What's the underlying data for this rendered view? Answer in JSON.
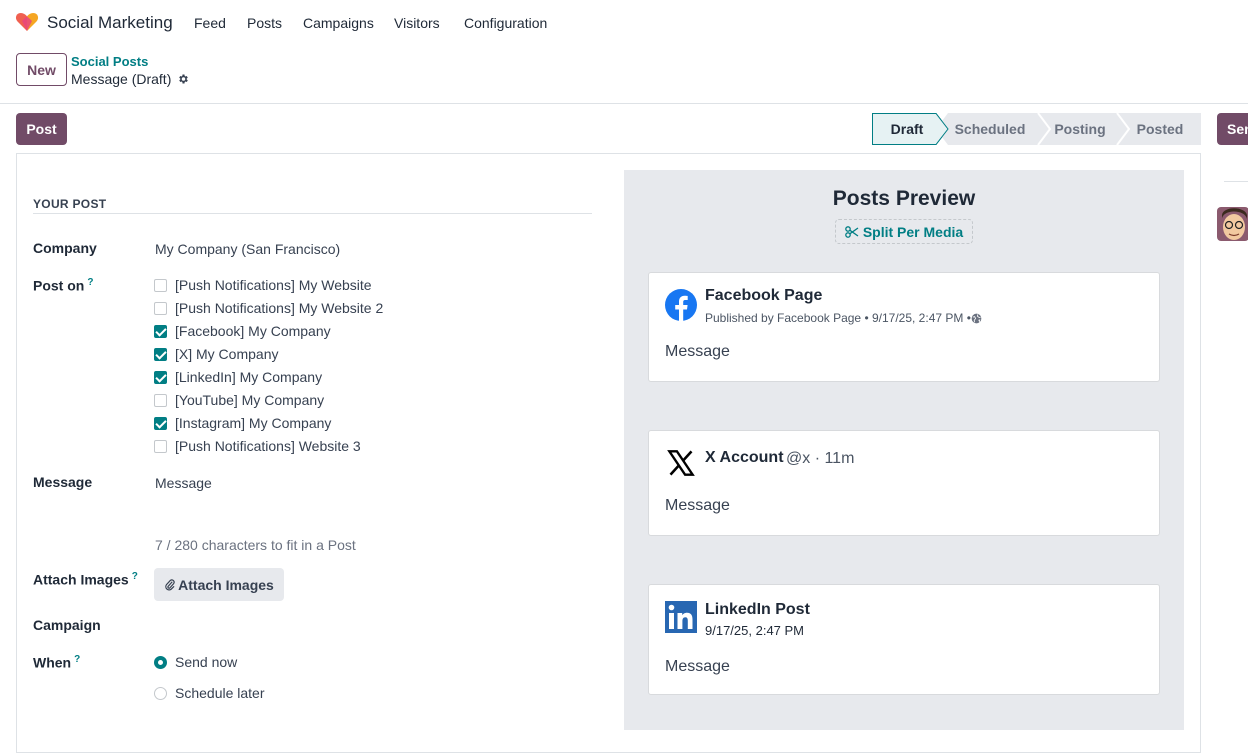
{
  "app": {
    "name": "Social Marketing",
    "menu": [
      "Feed",
      "Posts",
      "Campaigns",
      "Visitors",
      "Configuration"
    ]
  },
  "control_panel": {
    "new_label": "New",
    "breadcrumb_parent": "Social Posts",
    "breadcrumb_current": "Message (Draft)"
  },
  "actions": {
    "post_label": "Post",
    "right_label": "Send"
  },
  "status": {
    "stages": [
      "Draft",
      "Scheduled",
      "Posting",
      "Posted"
    ],
    "active": "Draft"
  },
  "form": {
    "section_title": "YOUR POST",
    "company_label": "Company",
    "company_value": "My Company (San Francisco)",
    "post_on_label": "Post on",
    "help_mark": "?",
    "accounts": [
      {
        "label": "[Push Notifications] My Website",
        "checked": false
      },
      {
        "label": "[Push Notifications] My Website 2",
        "checked": false
      },
      {
        "label": "[Facebook] My Company",
        "checked": true
      },
      {
        "label": "[X] My Company",
        "checked": true
      },
      {
        "label": "[LinkedIn] My Company",
        "checked": true
      },
      {
        "label": "[YouTube] My Company",
        "checked": false
      },
      {
        "label": "[Instagram] My Company",
        "checked": true
      },
      {
        "label": "[Push Notifications] Website 3",
        "checked": false
      }
    ],
    "message_label": "Message",
    "message_value": "Message",
    "char_counter": "7 / 280 characters to fit in a Post",
    "attach_label": "Attach Images",
    "attach_button": "Attach Images",
    "campaign_label": "Campaign",
    "when_label": "When",
    "when_options": [
      {
        "label": "Send now",
        "selected": true
      },
      {
        "label": "Schedule later",
        "selected": false
      }
    ]
  },
  "preview": {
    "title": "Posts Preview",
    "split_label": "Split Per Media",
    "facebook": {
      "title": "Facebook Page",
      "meta": "Published by Facebook Page • 9/17/25, 2:47 PM •",
      "message": "Message"
    },
    "x": {
      "title": "X Account",
      "handle": "@x · 11m",
      "message": "Message"
    },
    "linkedin": {
      "title": "LinkedIn Post",
      "date": "9/17/25, 2:47 PM",
      "message": "Message"
    }
  },
  "colors": {
    "brand": "#714b67",
    "accent": "#017e84",
    "facebook": "#1877f2",
    "linkedin": "#2867b2"
  },
  "icons": [
    "heart-logo-icon",
    "gear-icon",
    "scissors-icon",
    "paperclip-icon",
    "facebook-icon",
    "globe-icon",
    "x-logo-icon",
    "linkedin-icon"
  ]
}
